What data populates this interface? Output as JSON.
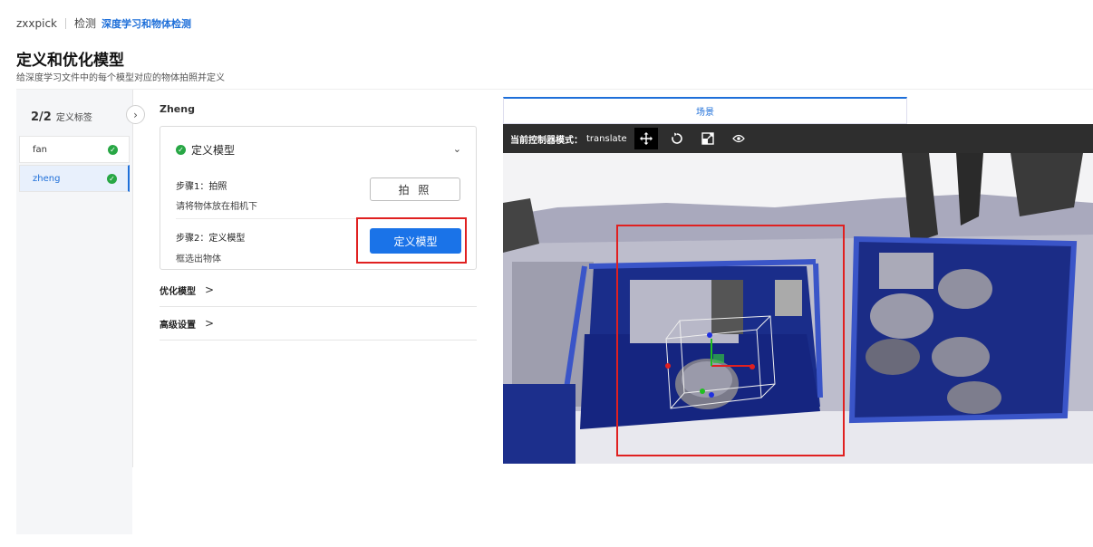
{
  "breadcrumb": {
    "home": "zxxpick",
    "section": "检测",
    "current": "深度学习和物体检测"
  },
  "page": {
    "title": "定义和优化模型",
    "subtitle": "给深度学习文件中的每个模型对应的物体拍照并定义"
  },
  "sidebar": {
    "step_count": "2/2",
    "step_label": "定义标签",
    "items": [
      {
        "label": "fan",
        "checked": true,
        "active": false
      },
      {
        "label": "zheng",
        "checked": true,
        "active": true
      }
    ]
  },
  "panel": {
    "object_name": "Zheng",
    "card": {
      "title": "定义模型",
      "step1_title": "步骤1：拍照",
      "step1_desc": "请将物体放在相机下",
      "step1_button": "拍 照",
      "step2_title": "步骤2：定义模型",
      "step2_desc": "框选出物体",
      "step2_button": "定义模型"
    },
    "sections": [
      {
        "label": "优化模型"
      },
      {
        "label": "高级设置"
      }
    ]
  },
  "viewer": {
    "tab": "场景",
    "mode_label": "当前控制器模式：",
    "mode_value": "translate",
    "tools": [
      "move-icon",
      "rotate-icon",
      "scale-icon",
      "eye-icon"
    ]
  },
  "colors": {
    "accent": "#1a73e8",
    "success": "#28a745",
    "highlight": "#e02020",
    "toolbar": "#2e2e2e"
  }
}
